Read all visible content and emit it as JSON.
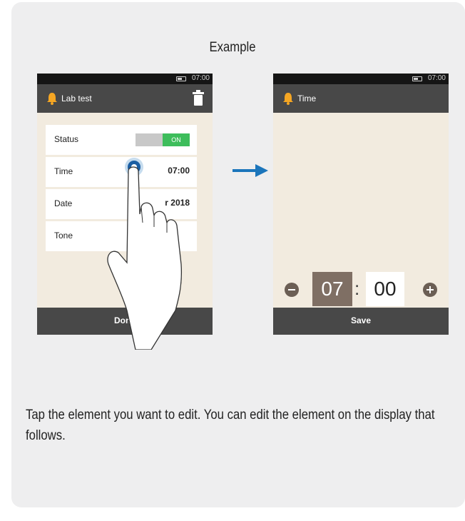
{
  "title": "Example",
  "left_screen": {
    "status_time": "07:00",
    "header_title": "Lab test",
    "rows": [
      {
        "label": "Status",
        "value": "ON",
        "type": "toggle"
      },
      {
        "label": "Time",
        "value": "07:00"
      },
      {
        "label": "Date",
        "value": "r 2018"
      },
      {
        "label": "Tone",
        "value": ""
      }
    ],
    "bottom_button": "Done"
  },
  "right_screen": {
    "status_time": "07:00",
    "header_title": "Time",
    "hour": "07",
    "separator": ":",
    "minute": "00",
    "bottom_button": "Save"
  },
  "instructions": "Tap the element you want to edit. You can edit the element on the display that follows.",
  "icons": {
    "bell": "bell-icon",
    "trash": "trash-icon",
    "arrow": "arrow-right-icon",
    "minus": "minus-icon",
    "plus": "plus-icon",
    "hand": "hand-pointer-icon"
  },
  "colors": {
    "accent_arrow": "#1b75bb",
    "toggle_on": "#3dbd5b",
    "bell": "#f5a623",
    "hour_box": "#7f6f64"
  }
}
